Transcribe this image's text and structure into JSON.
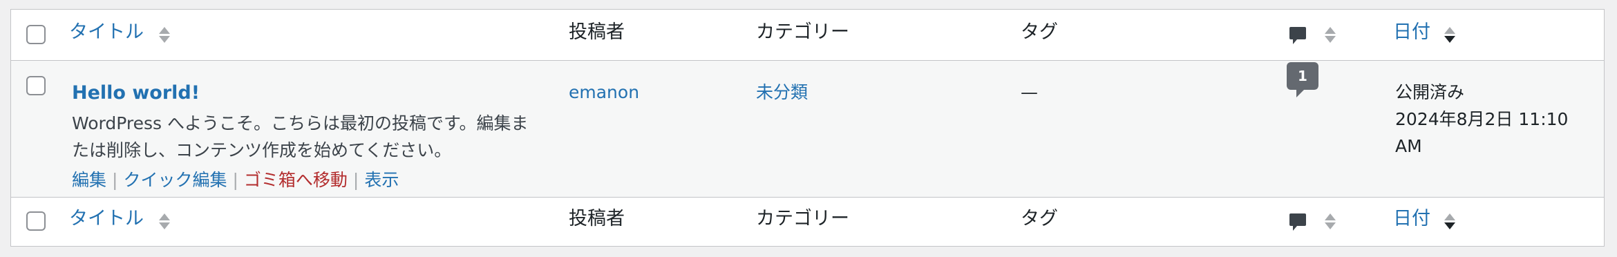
{
  "columns": {
    "title": "タイトル",
    "author": "投稿者",
    "categories": "カテゴリー",
    "tags": "タグ",
    "date": "日付"
  },
  "post": {
    "title": "Hello world!",
    "excerpt": "WordPress へようこそ。こちらは最初の投稿です。編集または削除し、コンテンツ作成を始めてください。",
    "actions": {
      "edit": "編集",
      "quick_edit": "クイック編集",
      "trash": "ゴミ箱へ移動",
      "view": "表示"
    },
    "author": "emanon",
    "category": "未分類",
    "tags": "—",
    "comment_count": "1",
    "status": "公開済み",
    "date": "2024年8月2日 11:10 AM"
  },
  "colors": {
    "link": "#2271b1",
    "trash": "#b32d2e",
    "border": "#c3c4c7",
    "row_bg": "#f6f7f7"
  },
  "icons": {
    "comment_header": "comment-bubble-icon",
    "sort": "sort-arrows-icon"
  }
}
